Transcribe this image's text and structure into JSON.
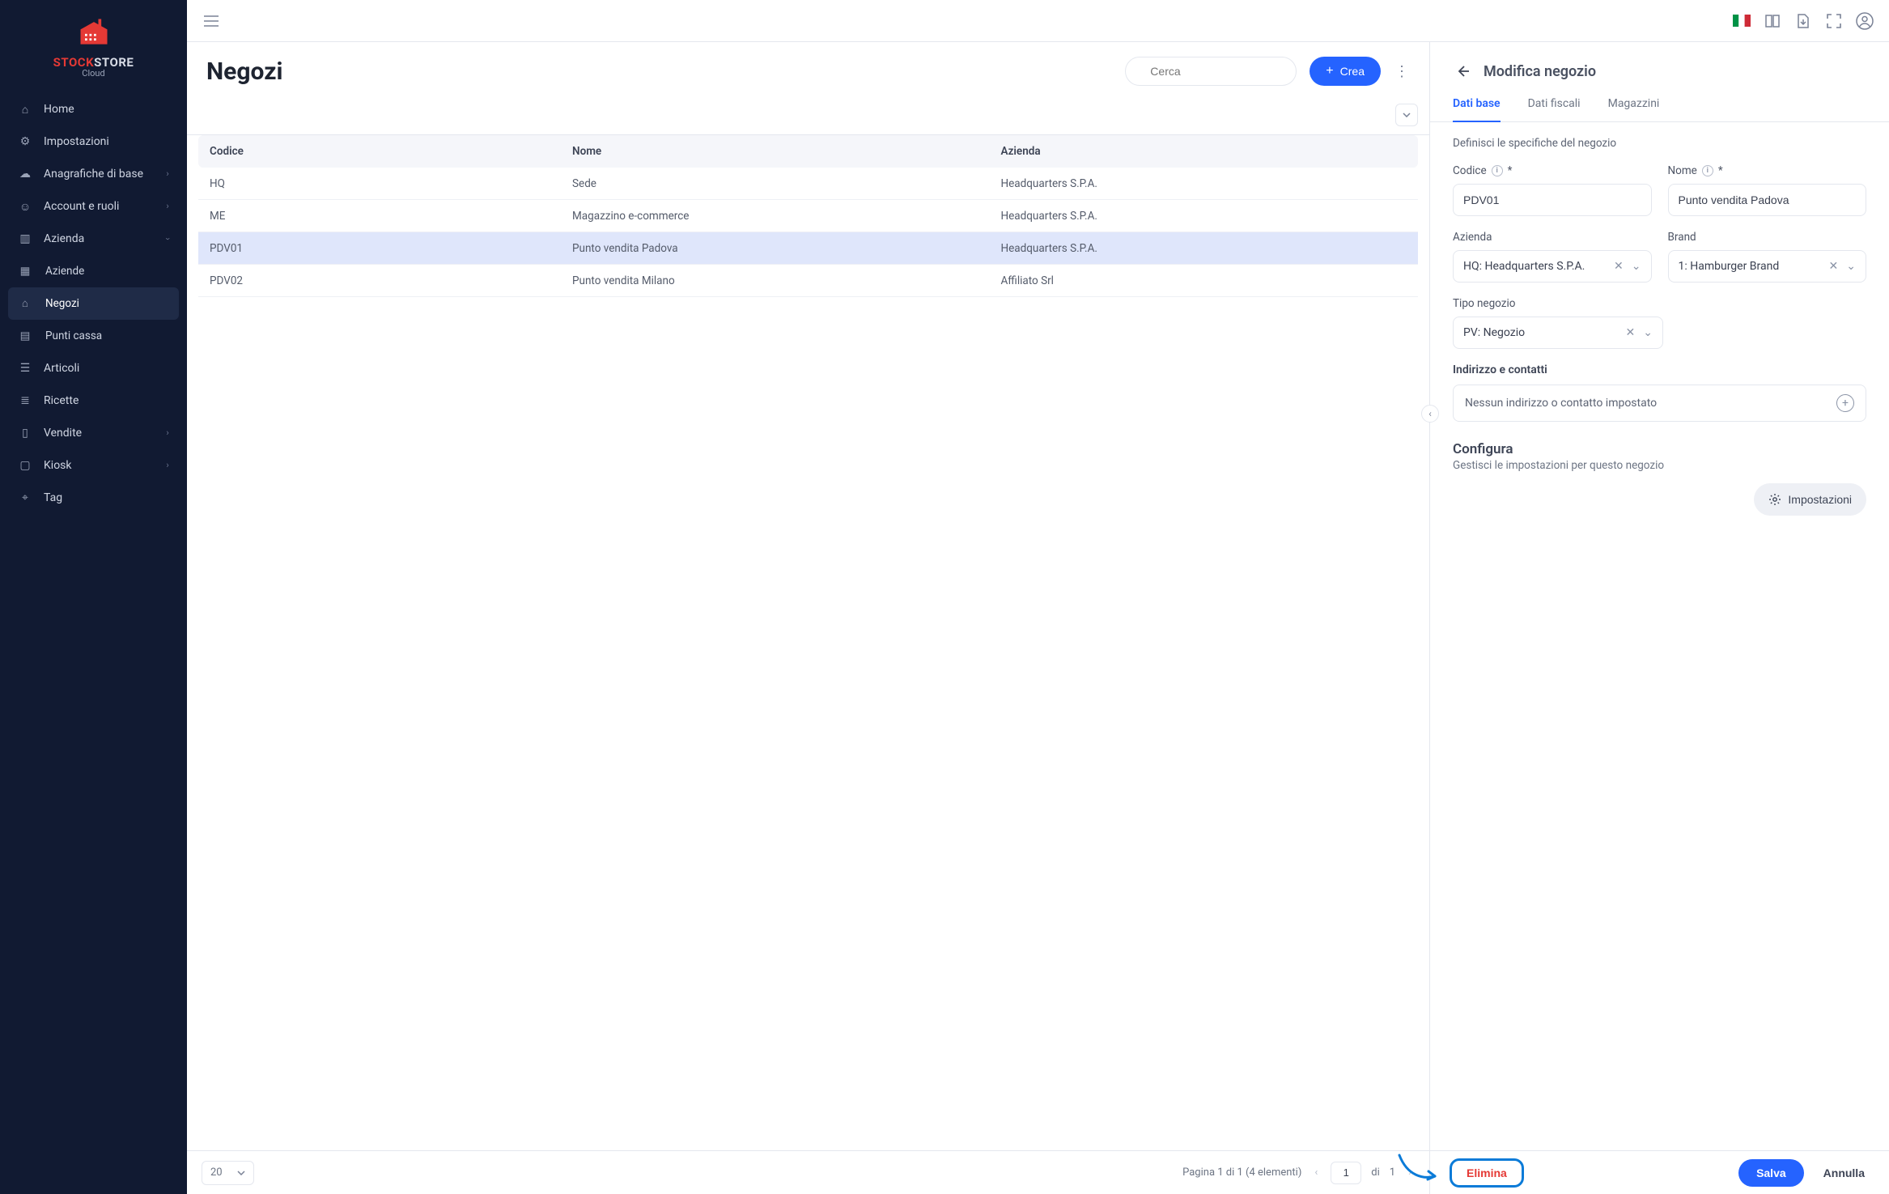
{
  "brand": {
    "line1a": "STOCK",
    "line1b": "STORE",
    "line2": "Cloud"
  },
  "sidebar": {
    "items": [
      {
        "label": "Home"
      },
      {
        "label": "Impostazioni"
      },
      {
        "label": "Anagrafiche di base"
      },
      {
        "label": "Account e ruoli"
      },
      {
        "label": "Azienda"
      },
      {
        "label": "Aziende"
      },
      {
        "label": "Negozi"
      },
      {
        "label": "Punti cassa"
      },
      {
        "label": "Articoli"
      },
      {
        "label": "Ricette"
      },
      {
        "label": "Vendite"
      },
      {
        "label": "Kiosk"
      },
      {
        "label": "Tag"
      }
    ]
  },
  "list": {
    "title": "Negozi",
    "search_placeholder": "Cerca",
    "create_label": "Crea",
    "columns": {
      "code": "Codice",
      "name": "Nome",
      "company": "Azienda"
    },
    "rows": [
      {
        "code": "HQ",
        "name": "Sede",
        "company": "Headquarters S.P.A."
      },
      {
        "code": "ME",
        "name": "Magazzino e-commerce",
        "company": "Headquarters S.P.A."
      },
      {
        "code": "PDV01",
        "name": "Punto vendita Padova",
        "company": "Headquarters S.P.A."
      },
      {
        "code": "PDV02",
        "name": "Punto vendita Milano",
        "company": "Affiliato Srl"
      }
    ],
    "selected_index": 2,
    "page_size": "20",
    "pager_text": "Pagina 1 di 1 (4 elementi)",
    "page_input": "1",
    "of_label": "di",
    "total_pages": "1"
  },
  "detail": {
    "title": "Modifica negozio",
    "tabs": [
      {
        "label": "Dati base",
        "active": true
      },
      {
        "label": "Dati fiscali"
      },
      {
        "label": "Magazzini"
      }
    ],
    "hint": "Definisci le specifiche del negozio",
    "fields": {
      "code": {
        "label": "Codice",
        "required": "*",
        "value": "PDV01"
      },
      "name": {
        "label": "Nome",
        "required": "*",
        "value": "Punto vendita Padova"
      },
      "company": {
        "label": "Azienda",
        "value": "HQ: Headquarters S.P.A."
      },
      "brand": {
        "label": "Brand",
        "value": "1: Hamburger Brand"
      },
      "type": {
        "label": "Tipo negozio",
        "value": "PV: Negozio"
      }
    },
    "address": {
      "heading": "Indirizzo e contatti",
      "empty": "Nessun indirizzo o contatto impostato"
    },
    "config": {
      "heading": "Configura",
      "sub": "Gestisci le impostazioni per questo negozio",
      "button": "Impostazioni"
    },
    "footer": {
      "delete": "Elimina",
      "save": "Salva",
      "cancel": "Annulla"
    }
  }
}
